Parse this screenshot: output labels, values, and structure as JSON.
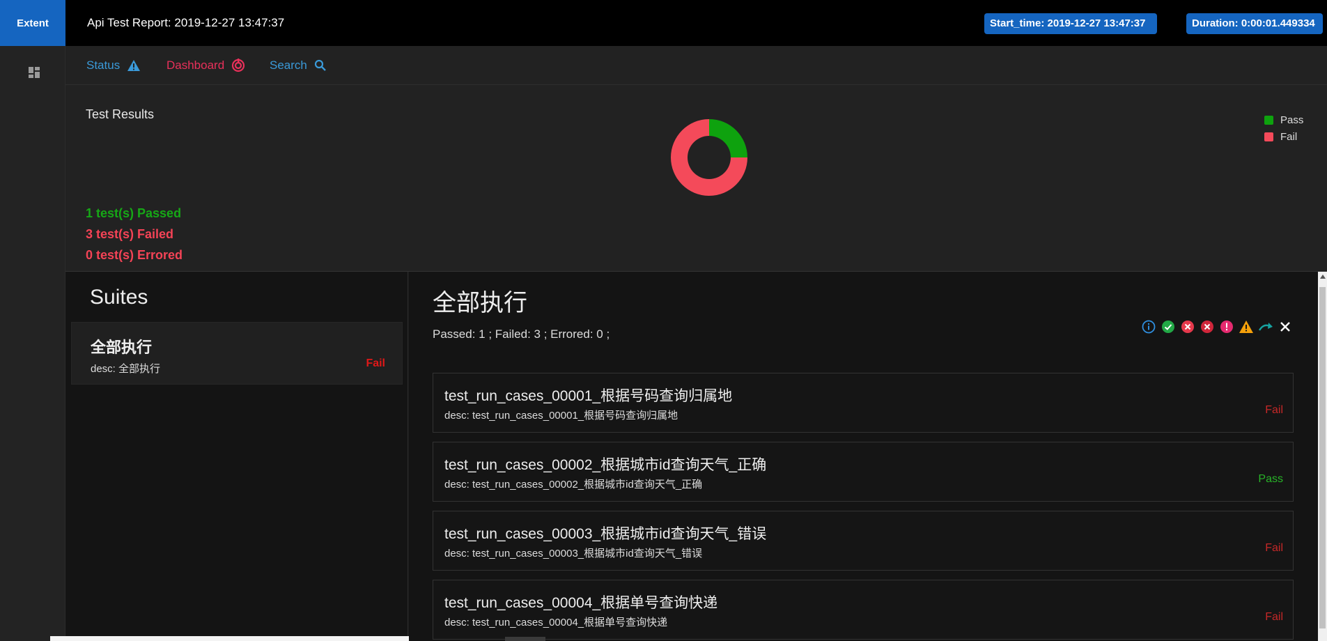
{
  "topbar": {
    "brand": "Extent",
    "title": "Api Test Report: 2019-12-27 13:47:37",
    "start_time": "Start_time: 2019-12-27 13:47:37",
    "duration": "Duration: 0:00:01.449334"
  },
  "rail": {
    "icon": "dashboard-grid-icon"
  },
  "nav": {
    "status_label": "Status",
    "status_icon": "warning-triangle-icon",
    "dashboard_label": "Dashboard",
    "dashboard_icon": "target-icon",
    "search_label": "Search",
    "search_icon": "magnifier-icon"
  },
  "dashboard": {
    "title": "Test Results",
    "legend": [
      {
        "label": "Pass",
        "color": "#0ea20e"
      },
      {
        "label": "Fail",
        "color": "#f44a5a"
      }
    ],
    "passed_text": "1 test(s) Passed",
    "failed_text": "3 test(s) Failed",
    "errored_text": "0 test(s) Errored"
  },
  "chart_data": {
    "type": "pie",
    "title": "",
    "categories": [
      "Pass",
      "Fail"
    ],
    "values": [
      1,
      3
    ],
    "colors": [
      "#0ea20e",
      "#f44a5a"
    ]
  },
  "suites": {
    "title": "Suites",
    "items": [
      {
        "name": "全部执行",
        "desc": "desc: 全部执行",
        "status": "Fail"
      }
    ]
  },
  "detail": {
    "title": "全部执行",
    "summary": "Passed: 1 ; Failed: 3 ; Errored: 0 ;",
    "filters": [
      {
        "name": "info-filter-icon",
        "color": "#2f8fe0"
      },
      {
        "name": "pass-filter-icon",
        "color": "#22a846"
      },
      {
        "name": "fail-filter-icon",
        "color": "#e5394c"
      },
      {
        "name": "error-filter-icon",
        "color": "#d0263a"
      },
      {
        "name": "fatal-filter-icon",
        "color": "#e52a6f"
      },
      {
        "name": "warning-filter-icon",
        "color": "#f5a00a"
      },
      {
        "name": "skip-filter-icon",
        "color": "#17a2a0"
      },
      {
        "name": "clear-filter-icon",
        "color": "#ffffff"
      }
    ],
    "tests": [
      {
        "name": "test_run_cases_00001_根据号码查询归属地",
        "desc": "desc: test_run_cases_00001_根据号码查询归属地",
        "status": "Fail"
      },
      {
        "name": "test_run_cases_00002_根据城市id查询天气_正确",
        "desc": "desc: test_run_cases_00002_根据城市id查询天气_正确",
        "status": "Pass"
      },
      {
        "name": "test_run_cases_00003_根据城市id查询天气_错误",
        "desc": "desc: test_run_cases_00003_根据城市id查询天气_错误",
        "status": "Fail"
      },
      {
        "name": "test_run_cases_00004_根据单号查询快递",
        "desc": "desc: test_run_cases_00004_根据单号查询快递",
        "status": "Fail"
      }
    ]
  }
}
